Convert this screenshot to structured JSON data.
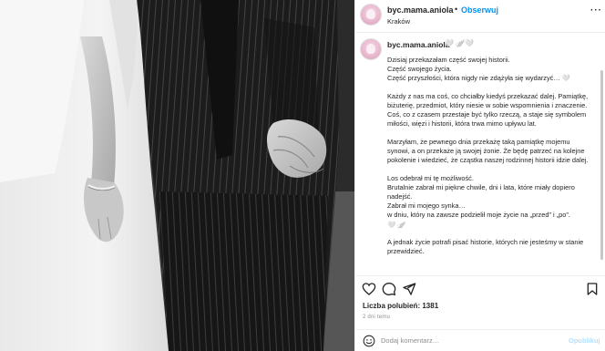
{
  "header": {
    "username": "byc.mama.aniola",
    "separator": "•",
    "follow_label": "Obserwuj",
    "location": "Kraków",
    "more_label": "···"
  },
  "caption": {
    "username": "byc.mama.aniola",
    "username_emojis": "🤍 🪽🤍",
    "paragraphs": [
      "Dzisiaj przekazałam część swojej historii.\nCzęść swojego życia.\nCzęść przyszłości, która nigdy nie zdążyła się wydarzyć… 🤍",
      "Każdy z nas ma coś, co chciałby kiedyś przekazać dalej. Pamiątkę, biżuterię, przedmiot, który niesie w sobie wspomnienia i znaczenie. Coś, co z czasem przestaje być tylko rzeczą, a staje się symbolem miłości, więzi i historii, która trwa mimo upływu lat.",
      "Marzyłam, że pewnego dnia przekażę taką pamiątkę mojemu synowi, a on przekaże ją swojej żonie. Że będę patrzeć na kolejne pokolenie i wiedzieć, że cząstka naszej rodzinnej historii idzie dalej.",
      "Los odebrał mi tę możliwość.\nBrutalnie zabrał mi piękne chwile, dni i lata, które miały dopiero nadejść.\nZabrał mi mojego synka…\nw dniu, który na zawsze podzielił moje życie na „przed” i „po”.\n🤍 🪽",
      "A jednak życie potrafi pisać historie, których nie jesteśmy w stanie przewidzieć."
    ]
  },
  "actions": {
    "like_icon": "heart-icon",
    "comment_icon": "comment-icon",
    "share_icon": "share-icon",
    "save_icon": "bookmark-icon"
  },
  "stats": {
    "likes_label": "Liczba polubień:",
    "likes_count": "1381",
    "posted": "2 dni temu"
  },
  "comment_box": {
    "placeholder": "Dodaj komentarz…",
    "value": "",
    "submit_label": "Opublikuj"
  }
}
